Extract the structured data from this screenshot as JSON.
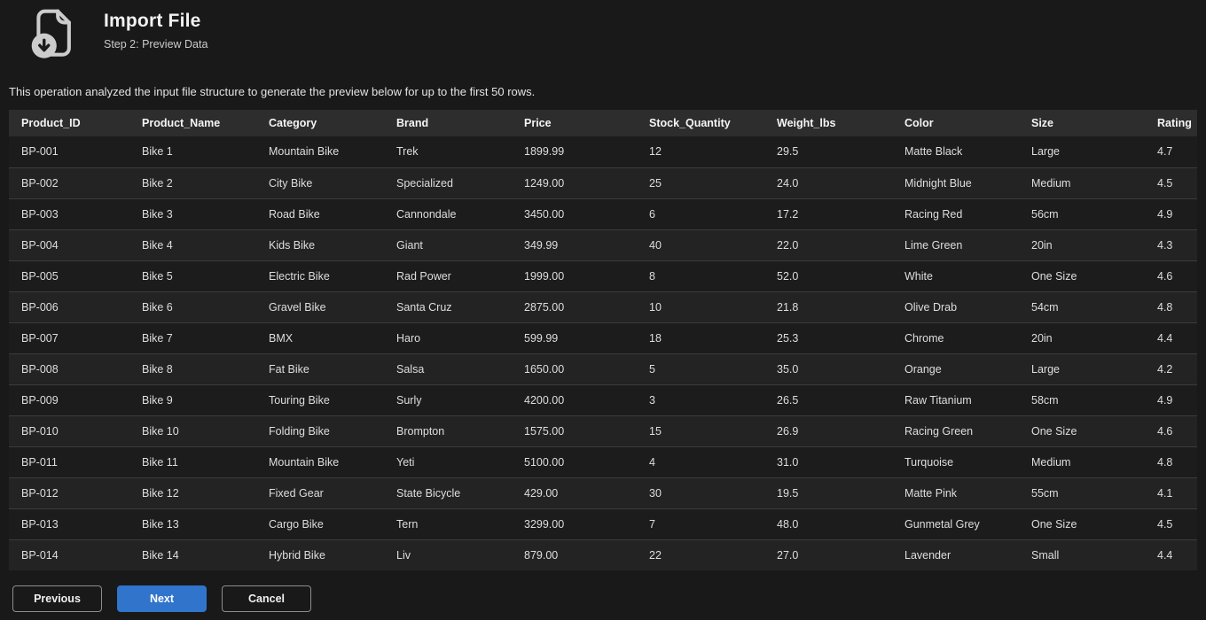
{
  "header": {
    "title": "Import File",
    "subtitle": "Step 2: Preview Data",
    "icon": "file-download-icon"
  },
  "description": "This operation analyzed the input file structure to generate the preview below for up to the first 50 rows.",
  "table": {
    "columns": [
      "Product_ID",
      "Product_Name",
      "Category",
      "Brand",
      "Price",
      "Stock_Quantity",
      "Weight_lbs",
      "Color",
      "Size",
      "Rating"
    ],
    "rows": [
      [
        "BP-001",
        "Bike 1",
        "Mountain Bike",
        "Trek",
        "1899.99",
        "12",
        "29.5",
        "Matte Black",
        "Large",
        "4.7"
      ],
      [
        "BP-002",
        "Bike 2",
        "City Bike",
        "Specialized",
        "1249.00",
        "25",
        "24.0",
        "Midnight Blue",
        "Medium",
        "4.5"
      ],
      [
        "BP-003",
        "Bike 3",
        "Road Bike",
        "Cannondale",
        "3450.00",
        "6",
        "17.2",
        "Racing Red",
        "56cm",
        "4.9"
      ],
      [
        "BP-004",
        "Bike 4",
        "Kids Bike",
        "Giant",
        "349.99",
        "40",
        "22.0",
        "Lime Green",
        "20in",
        "4.3"
      ],
      [
        "BP-005",
        "Bike 5",
        "Electric Bike",
        "Rad Power",
        "1999.00",
        "8",
        "52.0",
        "White",
        "One Size",
        "4.6"
      ],
      [
        "BP-006",
        "Bike 6",
        "Gravel Bike",
        "Santa Cruz",
        "2875.00",
        "10",
        "21.8",
        "Olive Drab",
        "54cm",
        "4.8"
      ],
      [
        "BP-007",
        "Bike 7",
        "BMX",
        "Haro",
        "599.99",
        "18",
        "25.3",
        "Chrome",
        "20in",
        "4.4"
      ],
      [
        "BP-008",
        "Bike 8",
        "Fat Bike",
        "Salsa",
        "1650.00",
        "5",
        "35.0",
        "Orange",
        "Large",
        "4.2"
      ],
      [
        "BP-009",
        "Bike 9",
        "Touring Bike",
        "Surly",
        "4200.00",
        "3",
        "26.5",
        "Raw Titanium",
        "58cm",
        "4.9"
      ],
      [
        "BP-010",
        "Bike 10",
        "Folding Bike",
        "Brompton",
        "1575.00",
        "15",
        "26.9",
        "Racing Green",
        "One Size",
        "4.6"
      ],
      [
        "BP-011",
        "Bike 11",
        "Mountain Bike",
        "Yeti",
        "5100.00",
        "4",
        "31.0",
        "Turquoise",
        "Medium",
        "4.8"
      ],
      [
        "BP-012",
        "Bike 12",
        "Fixed Gear",
        "State Bicycle",
        "429.00",
        "30",
        "19.5",
        "Matte Pink",
        "55cm",
        "4.1"
      ],
      [
        "BP-013",
        "Bike 13",
        "Cargo Bike",
        "Tern",
        "3299.00",
        "7",
        "48.0",
        "Gunmetal Grey",
        "One Size",
        "4.5"
      ],
      [
        "BP-014",
        "Bike 14",
        "Hybrid Bike",
        "Liv",
        "879.00",
        "22",
        "27.0",
        "Lavender",
        "Small",
        "4.4"
      ]
    ]
  },
  "buttons": {
    "previous": "Previous",
    "next": "Next",
    "cancel": "Cancel"
  },
  "colors": {
    "accent": "#3074cc",
    "background": "#191919",
    "table_header_bg": "#2d2d2d",
    "row_odd": "#1c1c1c",
    "row_even": "#232323",
    "divider": "#3c3c3c",
    "icon_gray": "#cccccc"
  }
}
